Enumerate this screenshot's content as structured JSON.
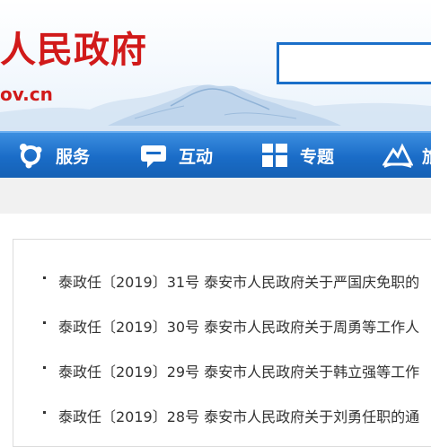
{
  "header": {
    "title": "人民政府",
    "domain": "ov.cn",
    "search": {
      "placeholder": ""
    }
  },
  "nav": {
    "items": [
      {
        "label": "服务",
        "icon": "service-icon"
      },
      {
        "label": "互动",
        "icon": "chat-icon"
      },
      {
        "label": "专题",
        "icon": "grid-icon"
      },
      {
        "label": "旅",
        "icon": "travel-icon"
      }
    ]
  },
  "documents": [
    {
      "title": "泰政任〔2019〕31号 泰安市人民政府关于严国庆免职的"
    },
    {
      "title": "泰政任〔2019〕30号 泰安市人民政府关于周勇等工作人"
    },
    {
      "title": "泰政任〔2019〕29号 泰安市人民政府关于韩立强等工作"
    },
    {
      "title": "泰政任〔2019〕28号 泰安市人民政府关于刘勇任职的通"
    }
  ],
  "colors": {
    "brand_red": "#d11a1a",
    "nav_blue": "#1a6cc7",
    "search_border": "#1a6fc9"
  }
}
